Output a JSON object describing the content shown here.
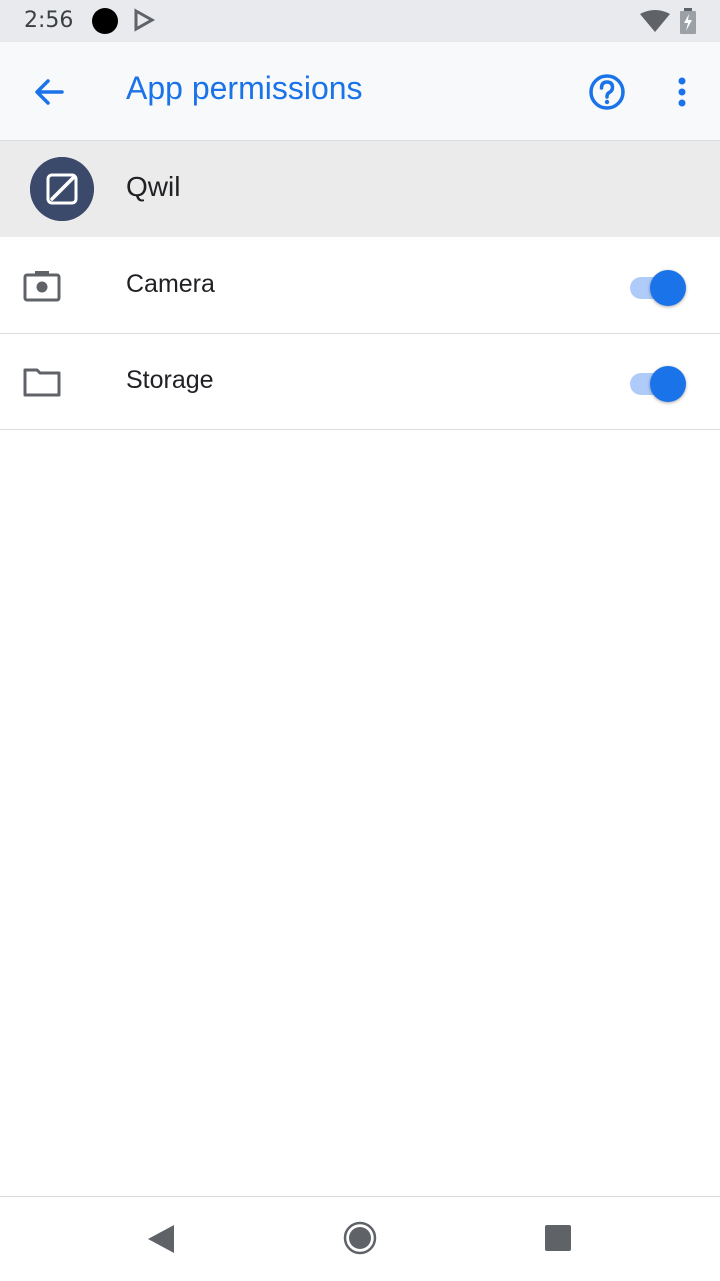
{
  "status_bar": {
    "time": "2:56",
    "icons": [
      "notification-dot-icon",
      "play-store-icon",
      "wifi-icon",
      "battery-charging-icon"
    ]
  },
  "app_bar": {
    "title": "App permissions",
    "back_icon": "arrow-back-icon",
    "help_icon": "help-circle-icon",
    "more_icon": "more-vert-icon"
  },
  "app": {
    "name": "Qwil",
    "icon": "qwil-app-icon"
  },
  "permissions": [
    {
      "label": "Camera",
      "icon": "camera-icon",
      "enabled": true
    },
    {
      "label": "Storage",
      "icon": "folder-icon",
      "enabled": true
    }
  ],
  "nav_bar": {
    "back_icon": "nav-back-icon",
    "home_icon": "nav-home-icon",
    "recents_icon": "nav-recents-icon"
  },
  "colors": {
    "accent": "#1a73e8",
    "toggle_track": "#aecbfa",
    "header_bg": "#ebebeb",
    "app_bar_bg": "#f8f9fa"
  }
}
